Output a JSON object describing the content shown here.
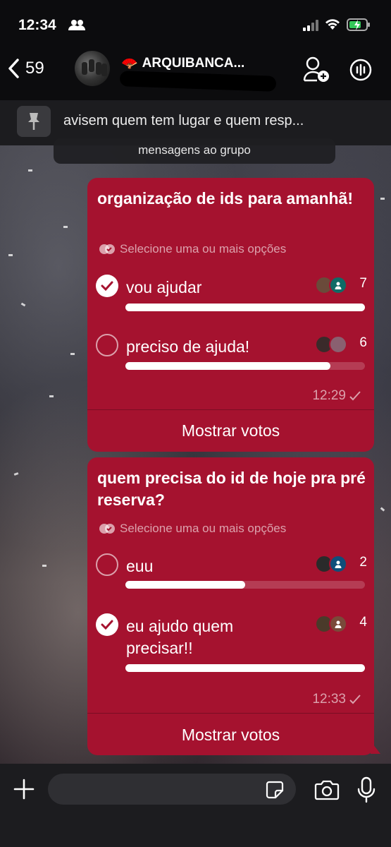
{
  "status_bar": {
    "time": "12:34"
  },
  "header": {
    "back_count": "59",
    "group_emoji": "🪭",
    "group_name": "ARQUIBANCA..."
  },
  "pinned": {
    "text": "avisem quem tem lugar e quem resp..."
  },
  "system_notice": "mensagens ao grupo",
  "polls": [
    {
      "question": "organização de ids para amanhã!",
      "hint": "Selecione uma ou mais opções",
      "options": [
        {
          "label": "vou ajudar",
          "votes": "7",
          "selected": true,
          "fraction": 1.0
        },
        {
          "label": "preciso de ajuda!",
          "votes": "6",
          "selected": false,
          "fraction": 0.857
        }
      ],
      "time": "12:29",
      "show_votes": "Mostrar votos"
    },
    {
      "question": "quem precisa do id de hoje pra pré reserva?",
      "hint": "Selecione uma ou mais opções",
      "options": [
        {
          "label": "euu",
          "votes": "2",
          "selected": false,
          "fraction": 0.5
        },
        {
          "label": "eu ajudo quem precisar!!",
          "votes": "4",
          "selected": true,
          "fraction": 1.0
        }
      ],
      "time": "12:33",
      "show_votes": "Mostrar votos"
    }
  ],
  "colors": {
    "bubble": "#a5122f",
    "header_bg": "#0c0c0e",
    "input_bar": "#1c1c1f"
  },
  "icons": {
    "back": "chevron-left-icon",
    "add_user": "add-user-icon",
    "audio": "audio-chat-icon",
    "pin": "pin-icon",
    "plus": "plus-icon",
    "sticker": "sticker-icon",
    "camera": "camera-icon",
    "mic": "microphone-icon"
  }
}
